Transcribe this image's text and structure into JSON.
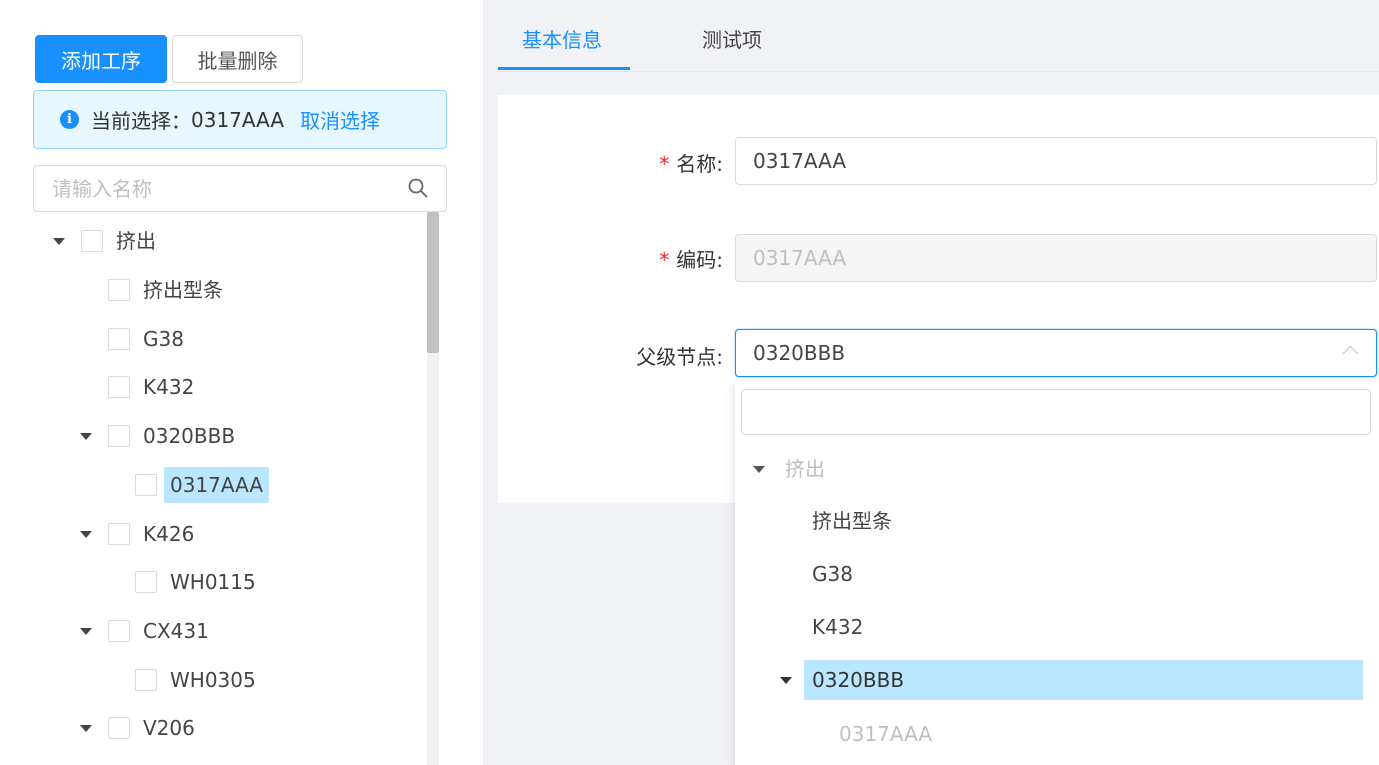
{
  "toolbar": {
    "add_label": "添加工序",
    "batch_delete_label": "批量删除"
  },
  "selection_alert": {
    "prefix": "当前选择：",
    "value": "0317AAA",
    "cancel_label": "取消选择"
  },
  "tree_search": {
    "placeholder": "请输入名称"
  },
  "tree": [
    {
      "label": "挤出",
      "level": 0,
      "expandable": true
    },
    {
      "label": "挤出型条",
      "level": 1,
      "expandable": false
    },
    {
      "label": "G38",
      "level": 1,
      "expandable": false
    },
    {
      "label": "K432",
      "level": 1,
      "expandable": false
    },
    {
      "label": "0320BBB",
      "level": 1,
      "expandable": true
    },
    {
      "label": "0317AAA",
      "level": 2,
      "expandable": false,
      "selected": true
    },
    {
      "label": "K426",
      "level": 1,
      "expandable": true
    },
    {
      "label": "WH0115",
      "level": 2,
      "expandable": false
    },
    {
      "label": "CX431",
      "level": 1,
      "expandable": true
    },
    {
      "label": "WH0305",
      "level": 2,
      "expandable": false
    },
    {
      "label": "V206",
      "level": 1,
      "expandable": true
    }
  ],
  "tabs": [
    {
      "label": "基本信息",
      "active": true
    },
    {
      "label": "测试项",
      "active": false
    }
  ],
  "form": {
    "name_label": "名称",
    "name_value": "0317AAA",
    "code_label": "编码",
    "code_value": "0317AAA",
    "parent_label": "父级节点",
    "parent_value": "0320BBB",
    "label_suffix": ":",
    "required_mark": "*"
  },
  "parent_dropdown": {
    "search_value": "",
    "options": [
      {
        "label": "挤出",
        "level": 0,
        "expandable": true,
        "disabled": true
      },
      {
        "label": "挤出型条",
        "level": 1,
        "expandable": false
      },
      {
        "label": "G38",
        "level": 1,
        "expandable": false
      },
      {
        "label": "K432",
        "level": 1,
        "expandable": false
      },
      {
        "label": "0320BBB",
        "level": 1,
        "expandable": true,
        "highlighted": true
      },
      {
        "label": "0317AAA",
        "level": 2,
        "expandable": false,
        "disabled": true
      }
    ]
  },
  "colors": {
    "primary": "#1890ff",
    "selected_bg": "#bae7ff",
    "alert_bg": "#e6f7ff",
    "required": "#f5222d",
    "page_bg": "#f0f2f5"
  },
  "icons": {
    "search": "search-icon",
    "info": "info-icon",
    "tree_caret": "caret-down-icon",
    "select_arrow": "chevron-up-icon"
  }
}
